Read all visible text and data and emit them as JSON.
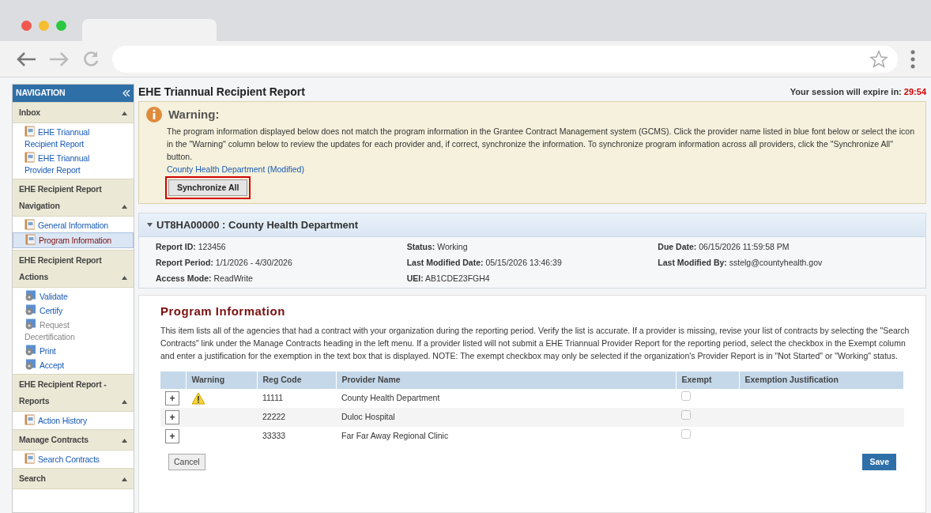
{
  "sidebar": {
    "title": "NAVIGATION",
    "sections": [
      {
        "title": "Inbox",
        "expanded": true,
        "items": [
          {
            "label": "EHE Triannual Recipient Report",
            "kind": "report",
            "selected": false,
            "disabled": false
          },
          {
            "label": "EHE Triannual Provider Report",
            "kind": "report",
            "selected": false,
            "disabled": false
          }
        ]
      },
      {
        "title": "EHE Recipient Report Navigation",
        "expanded": true,
        "items": [
          {
            "label": "General Information",
            "kind": "report",
            "selected": false,
            "disabled": false
          },
          {
            "label": "Program Information",
            "kind": "report",
            "selected": true,
            "disabled": false
          }
        ]
      },
      {
        "title": "EHE Recipient Report Actions",
        "expanded": true,
        "items": [
          {
            "label": "Validate",
            "kind": "action",
            "selected": false,
            "disabled": false
          },
          {
            "label": "Certify",
            "kind": "action",
            "selected": false,
            "disabled": false
          },
          {
            "label": "Request Decertification",
            "kind": "action",
            "selected": false,
            "disabled": true
          },
          {
            "label": "Print",
            "kind": "action",
            "selected": false,
            "disabled": false
          },
          {
            "label": "Accept",
            "kind": "action",
            "selected": false,
            "disabled": false
          }
        ]
      },
      {
        "title": "EHE Recipient Report - Reports",
        "expanded": true,
        "items": [
          {
            "label": "Action History",
            "kind": "report",
            "selected": false,
            "disabled": false
          }
        ]
      },
      {
        "title": "Manage Contracts",
        "expanded": true,
        "items": [
          {
            "label": "Search Contracts",
            "kind": "report",
            "selected": false,
            "disabled": false
          }
        ]
      },
      {
        "title": "Search",
        "expanded": true
      }
    ]
  },
  "page_title": "EHE Triannual Recipient Report",
  "session": {
    "label": "Your session will expire in:",
    "time": "29:54"
  },
  "warning": {
    "title": "Warning:",
    "message": "The program information displayed below does not match the program information in the Grantee Contract Management system (GCMS). Click the provider name listed in blue font below or select the icon in the \"Warning\" column below to review the updates for each provider and, if correct, synchronize the information. To synchronize program information across all providers, click the \"Synchronize All\" button.",
    "link": "County Health Department (Modified)",
    "button": "Synchronize All"
  },
  "record": {
    "heading": "UT8HA00000 : County Health Department",
    "expanded": true,
    "fields": [
      {
        "label": "Report ID:",
        "value": "123456"
      },
      {
        "label": "Status:",
        "value": "Working"
      },
      {
        "label": "Due Date:",
        "value": "06/15/2026 11:59:58 PM"
      },
      {
        "label": "Report Period:",
        "value": "1/1/2026 - 4/30/2026"
      },
      {
        "label": "Last Modified Date:",
        "value": "05/15/2026 13:46:39"
      },
      {
        "label": "Last Modified By:",
        "value": "sstelg@countyhealth.gov"
      },
      {
        "label": "Access Mode:",
        "value": "ReadWrite"
      },
      {
        "label": "UEI:",
        "value": "AB1CDE23FGH4"
      }
    ]
  },
  "program": {
    "title": "Program Information",
    "description": "This item lists all of the agencies that had a contract with your organization during the reporting period. Verify the list is accurate. If a provider is missing, revise your list of contracts by selecting the \"Search Contracts\" link under the Manage Contracts heading in the left menu. If a provider listed will not submit a EHE Triannual Provider Report for the reporting period, select the checkbox in the Exempt column and enter a justification for the exemption in the text box that is displayed. NOTE: The exempt checkbox may only be selected if the organization's Provider Report is in \"Not Started\" or \"Working\" status.",
    "columns": [
      "Warning",
      "Reg Code",
      "Provider Name",
      "Exempt",
      "Exemption Justification"
    ],
    "rows": [
      {
        "expand": "+",
        "warning": true,
        "reg_code": "11111",
        "provider": "County Health Department",
        "exempt": false
      },
      {
        "expand": "+",
        "warning": false,
        "reg_code": "22222",
        "provider": "Duloc Hospital",
        "exempt": false
      },
      {
        "expand": "+",
        "warning": false,
        "reg_code": "33333",
        "provider": "Far Far Away Regional Clinic",
        "exempt": false
      }
    ]
  },
  "buttons": {
    "cancel": "Cancel",
    "save": "Save"
  }
}
